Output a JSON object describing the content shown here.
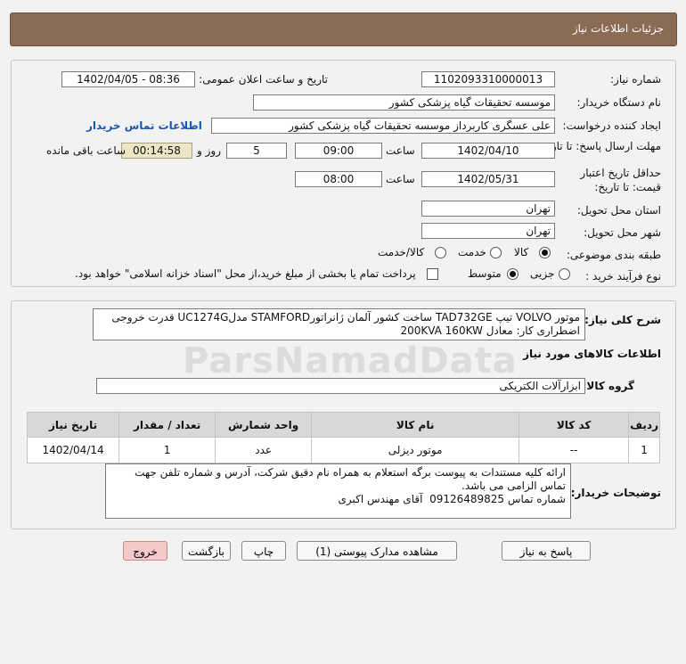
{
  "page_title": "جزئیات اطلاعات نیاز",
  "fields": {
    "need_number_label": "شماره نیاز:",
    "need_number": "1102093310000013",
    "announce_label": "تاریخ و ساعت اعلان عمومی:",
    "announce_value": "1402/04/05 - 08:36",
    "buyer_org_label": "نام دستگاه خریدار:",
    "buyer_org": "موسسه تحقیقات گیاه پزشکی کشور",
    "creator_label": "ایجاد کننده درخواست:",
    "creator": "علی عسگری کاربرداز موسسه تحقیقات گیاه پزشکی کشور",
    "buyer_contact_link": "اطلاعات تماس خریدار",
    "reply_deadline_label": "مهلت ارسال پاسخ: تا تاریخ:",
    "reply_date": "1402/04/10",
    "time_label": "ساعت",
    "reply_time": "09:00",
    "days_value": "5",
    "days_label": "روز و",
    "remaining_time": "00:14:58",
    "remaining_label": "ساعت باقی مانده",
    "price_validity_label_1": "حداقل تاریخ اعتبار",
    "price_validity_label_2": "قیمت: تا تاریخ:",
    "price_validity_date": "1402/05/31",
    "price_validity_time": "08:00",
    "delivery_province_label": "استان محل تحویل:",
    "delivery_province": "تهران",
    "delivery_city_label": "شهر محل تحویل:",
    "delivery_city": "تهران",
    "category_label": "طبقه بندی موضوعی:",
    "category_options": [
      "کالا",
      "خدمت",
      "کالا/خدمت"
    ],
    "purchase_type_label": "نوع فرآیند خرید :",
    "purchase_options": [
      "جزیی",
      "متوسط"
    ],
    "treasury_note": "پرداخت تمام یا بخشی از مبلغ خرید،از محل \"اسناد خزانه اسلامی\" خواهد بود."
  },
  "description": {
    "label": "شرح کلی نیاز:",
    "line1": "موتور VOLVO تیپ TAD732GE ساخت کشور آلمان ژانراتورSTAMFORD مدلUC1274G  قدرت خروجی",
    "line2": "اضطراری کار: معادل 200KVA 160KW"
  },
  "goods_section_title": "اطلاعات کالاهای مورد نیاز",
  "goods_group_label": "گروه کالا:",
  "goods_group": "ابزارآلات الکتریکی",
  "table": {
    "headers": [
      "ردیف",
      "کد کالا",
      "نام کالا",
      "واحد شمارش",
      "تعداد / مقدار",
      "تاریخ نیاز"
    ],
    "rows": [
      [
        "1",
        "--",
        "موتور دیزلی",
        "عدد",
        "1",
        "1402/04/14"
      ]
    ]
  },
  "buyer_notes": {
    "label": "توضیحات خریدار:",
    "text": "ارائه کلیه مستندات به پیوست برگه استعلام به همراه نام دقیق شرکت، آدرس و شماره تلفن جهت تماس الزامی می باشد.\nشماره تماس 09126489825  آقای مهندس اکبری"
  },
  "buttons": {
    "reply": "پاسخ به نیاز",
    "attachments": "مشاهده مدارک پیوستی (1)",
    "print": "چاپ",
    "back": "بازگشت",
    "exit": "خروج"
  },
  "watermark": "ParsNamadData",
  "colors": {
    "header": "#8c6b55",
    "link": "#1a56b0",
    "timer_bg": "#ece6c4",
    "exit_btn": "#f6c9c9"
  }
}
